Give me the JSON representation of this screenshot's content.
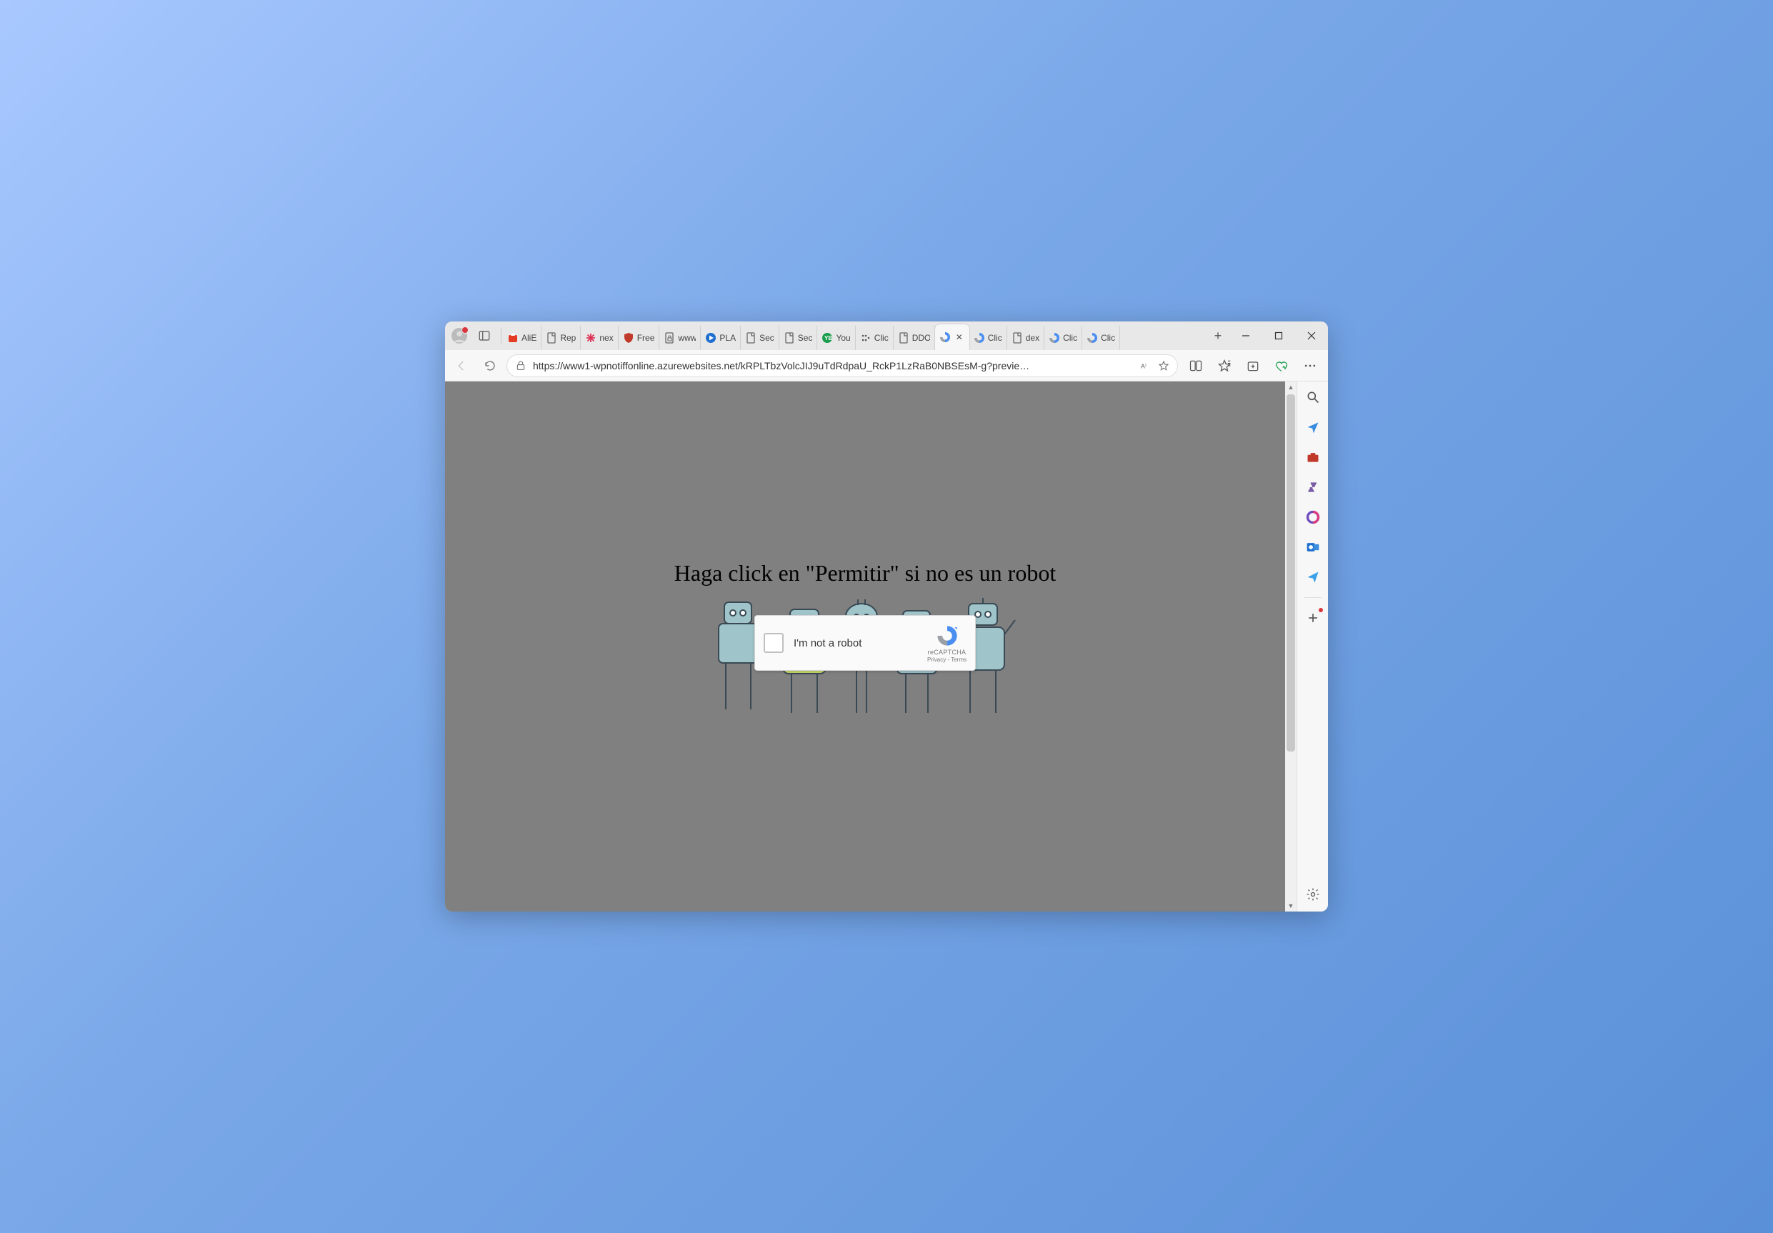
{
  "address_bar": {
    "url": "https://www1-wpnotiffonline.azurewebsites.net/kRPLTbzVolcJIJ9uTdRdpaU_RckP1LzRaB0NBSEsM-g?previe…"
  },
  "tabs": [
    {
      "label": "AliE",
      "icon": "bag"
    },
    {
      "label": "Rep",
      "icon": "page"
    },
    {
      "label": "nex",
      "icon": "asterisk"
    },
    {
      "label": "Free",
      "icon": "shield"
    },
    {
      "label": "www",
      "icon": "page-lock"
    },
    {
      "label": "PLA",
      "icon": "play"
    },
    {
      "label": "Sec",
      "icon": "page"
    },
    {
      "label": "Sec",
      "icon": "page"
    },
    {
      "label": "You",
      "icon": "circle"
    },
    {
      "label": "Clic",
      "icon": "dots"
    },
    {
      "label": "DDO",
      "icon": "page"
    },
    {
      "label": "",
      "icon": "recaptcha",
      "active": true,
      "closable": true
    },
    {
      "label": "Clic",
      "icon": "recaptcha"
    },
    {
      "label": "dex",
      "icon": "page"
    },
    {
      "label": "Clic",
      "icon": "recaptcha"
    },
    {
      "label": "Clic",
      "icon": "recaptcha"
    }
  ],
  "page": {
    "heading": "Haga click en \"Permitir\" si no es un robot",
    "captcha": {
      "label": "I'm not a robot",
      "brand": "reCAPTCHA",
      "privacy": "Privacy",
      "terms": "Terms",
      "sep": " - "
    }
  },
  "sidebar_icons": [
    "search",
    "tag",
    "briefcase",
    "piece",
    "office",
    "outlook",
    "send",
    "plus",
    "gear"
  ]
}
